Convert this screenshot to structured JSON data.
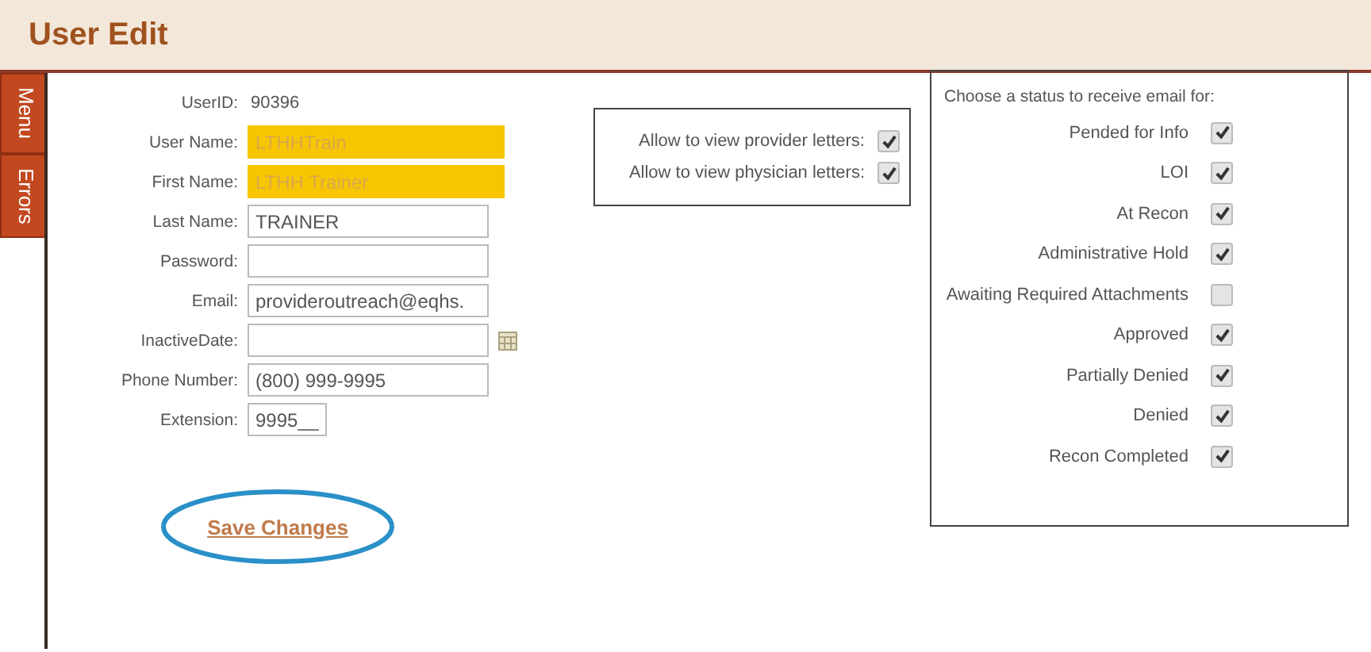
{
  "header": {
    "title": "User Edit"
  },
  "side_tabs": [
    {
      "label": "Menu"
    },
    {
      "label": "Errors"
    }
  ],
  "form": [
    {
      "kind": "static",
      "label": "UserID:",
      "value": "90396"
    },
    {
      "kind": "field",
      "label": "User Name:",
      "value": "LTHHTrain",
      "highlighted": true
    },
    {
      "kind": "field",
      "label": "First Name:",
      "value": "LTHH Trainer",
      "highlighted": true
    },
    {
      "kind": "field",
      "label": "Last Name:",
      "value": "TRAINER",
      "highlighted": false
    },
    {
      "kind": "field",
      "label": "Password:",
      "highlighted": false
    },
    {
      "kind": "field",
      "label": "Email:",
      "value": "provideroutreach@eqhs.",
      "highlighted": false
    },
    {
      "kind": "date",
      "label": "InactiveDate:",
      "highlighted": false
    },
    {
      "kind": "field",
      "label": "Phone Number:",
      "value": "(800) 999-9995",
      "highlighted": false
    },
    {
      "kind": "short",
      "label": "Extension:",
      "value": "9995__",
      "highlighted": false
    }
  ],
  "letters": [
    {
      "label": "Allow to view provider letters:",
      "checked": true
    },
    {
      "label": "Allow to view physician letters:",
      "checked": true
    }
  ],
  "statuses": {
    "heading": "Choose a status to receive email for:",
    "items": [
      {
        "label": "Pended for Info",
        "checked": true
      },
      {
        "label": "LOI",
        "checked": true
      },
      {
        "label": "At Recon",
        "checked": true
      },
      {
        "label": "Administrative Hold",
        "checked": true
      },
      {
        "label": "Awaiting Required Attachments",
        "checked": false
      },
      {
        "label": "Approved",
        "checked": true
      },
      {
        "label": "Partially Denied",
        "checked": true
      },
      {
        "label": "Denied",
        "checked": true
      },
      {
        "label": "Recon Completed",
        "checked": true
      }
    ]
  },
  "save_link": {
    "label": "Save Changes",
    "circled": true
  }
}
